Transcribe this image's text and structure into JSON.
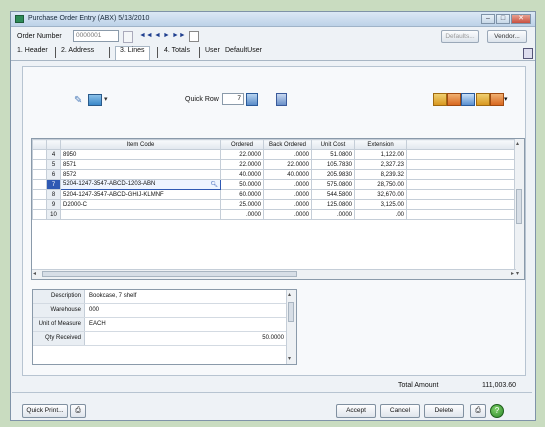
{
  "window": {
    "title": "Purchase Order Entry (ABX) 5/13/2010"
  },
  "order": {
    "label": "Order Number",
    "value": "0000001"
  },
  "toolbar": {
    "defaults_label": "Defaults...",
    "vendor_label": "Vendor..."
  },
  "tabs": [
    {
      "label": "1. Header"
    },
    {
      "label": "2. Address"
    },
    {
      "label": "3. Lines"
    },
    {
      "label": "4. Totals"
    },
    {
      "label": "User"
    }
  ],
  "user": {
    "value": "DefaultUser"
  },
  "quick_row": {
    "label": "Quick Row",
    "value": "7"
  },
  "grid": {
    "columns": [
      "Item Code",
      "Ordered",
      "Back Ordered",
      "Unit Cost",
      "Extension"
    ],
    "rows": [
      {
        "no": "4",
        "item": "8950",
        "ordered": "22.0000",
        "back": ".0000",
        "cost": "51.0800",
        "ext": "1,122.00"
      },
      {
        "no": "5",
        "item": "8571",
        "ordered": "22.0000",
        "back": "22.0000",
        "cost": "105.7830",
        "ext": "2,327.23"
      },
      {
        "no": "6",
        "item": "8572",
        "ordered": "40.0000",
        "back": "40.0000",
        "cost": "205.9830",
        "ext": "8,239.32"
      },
      {
        "no": "7",
        "item": "5204-1247-3547-ABCD-1203-ABN",
        "ordered": "50.0000",
        "back": ".0000",
        "cost": "575.0800",
        "ext": "28,750.00"
      },
      {
        "no": "8",
        "item": "5204-1247-3547-ABCD-GHIJ-KLMNF",
        "ordered": "60.0000",
        "back": ".0000",
        "cost": "544.5800",
        "ext": "32,670.00"
      },
      {
        "no": "9",
        "item": "D2000-C",
        "ordered": "25.0000",
        "back": ".0000",
        "cost": "125.0800",
        "ext": "3,125.00"
      },
      {
        "no": "10",
        "item": "",
        "ordered": ".0000",
        "back": ".0000",
        "cost": ".0000",
        "ext": ".00"
      }
    ]
  },
  "detail": {
    "description_label": "Description",
    "description": "Bookcase, 7 shelf",
    "warehouse_label": "Warehouse",
    "warehouse": "000",
    "uom_label": "Unit of Measure",
    "uom": "EACH",
    "qty_label": "Qty Received",
    "qty": "50.0000"
  },
  "totals": {
    "label": "Total Amount",
    "value": "111,003.60"
  },
  "buttons": {
    "quick_print": "Quick Print...",
    "accept": "Accept",
    "cancel": "Cancel",
    "delete": "Delete"
  },
  "colors": {
    "accent": "#2f59b3",
    "background": "#c9dcc0"
  }
}
